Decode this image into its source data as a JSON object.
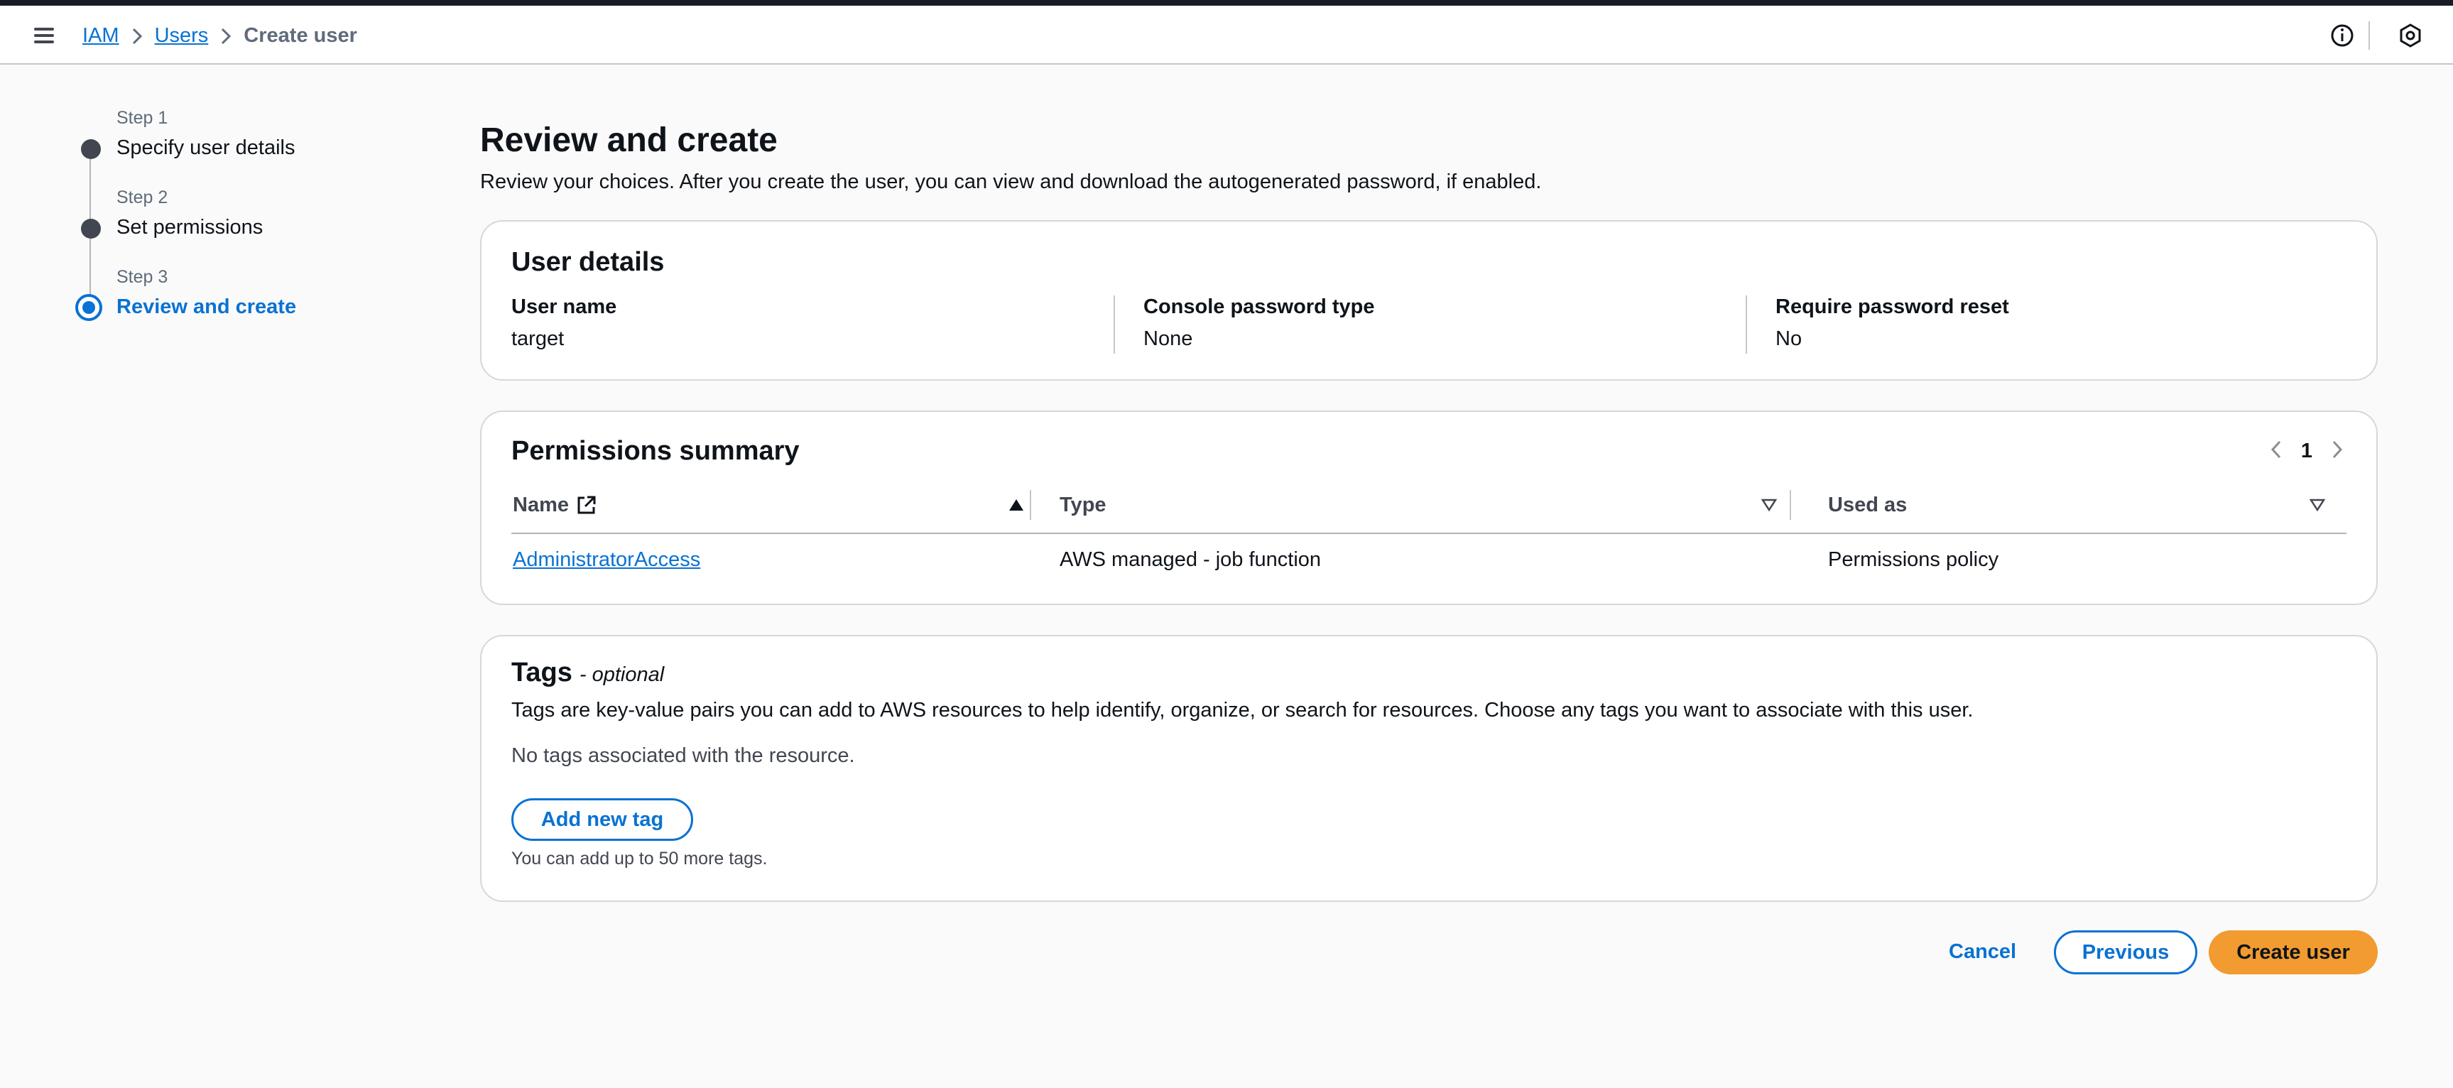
{
  "breadcrumb": {
    "items": [
      "IAM",
      "Users"
    ],
    "current": "Create user"
  },
  "wizard": {
    "steps": [
      {
        "label": "Step 1",
        "title": "Specify user details"
      },
      {
        "label": "Step 2",
        "title": "Set permissions"
      },
      {
        "label": "Step 3",
        "title": "Review and create"
      }
    ],
    "active_step": 3
  },
  "page": {
    "title": "Review and create",
    "description": "Review your choices. After you create the user, you can view and download the autogenerated password, if enabled."
  },
  "user_details": {
    "title": "User details",
    "fields": [
      {
        "key": "User name",
        "value": "target"
      },
      {
        "key": "Console password type",
        "value": "None"
      },
      {
        "key": "Require password reset",
        "value": "No"
      }
    ]
  },
  "permissions": {
    "title": "Permissions summary",
    "page": "1",
    "columns": [
      "Name",
      "Type",
      "Used as"
    ],
    "rows": [
      {
        "name": "AdministratorAccess",
        "type": "AWS managed - job function",
        "used_as": "Permissions policy"
      }
    ]
  },
  "tags": {
    "title": "Tags",
    "optional": "- optional",
    "description": "Tags are key-value pairs you can add to AWS resources to help identify, organize, or search for resources. Choose any tags you want to associate with this user.",
    "empty": "No tags associated with the resource.",
    "add_button": "Add new tag",
    "hint": "You can add up to 50 more tags."
  },
  "actions": {
    "cancel": "Cancel",
    "previous": "Previous",
    "create": "Create user"
  },
  "colors": {
    "accent": "#0972d3",
    "primary_button": "#f19b30",
    "header_strip": "#161d26"
  }
}
